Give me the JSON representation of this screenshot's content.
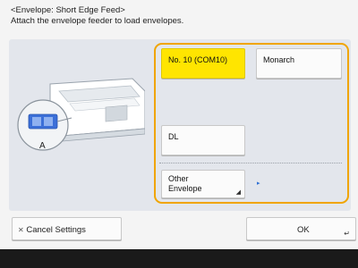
{
  "header": {
    "title": "<Envelope: Short Edge Feed>",
    "subtitle": "Attach the envelope feeder to load envelopes."
  },
  "illustration": {
    "label": "A"
  },
  "envelopes": {
    "no10": "No. 10 (COM10)",
    "monarch": "Monarch",
    "dl": "DL",
    "other_line1": "Other",
    "other_line2": "Envelope",
    "selected": "No. 10 (COM10)"
  },
  "footer": {
    "cancel_icon": "✕",
    "cancel_label": "Cancel Settings",
    "ok_label": "OK"
  },
  "colors": {
    "selected": "#ffe500",
    "group_border": "#f0a500",
    "panel": "#e3e6ec"
  }
}
